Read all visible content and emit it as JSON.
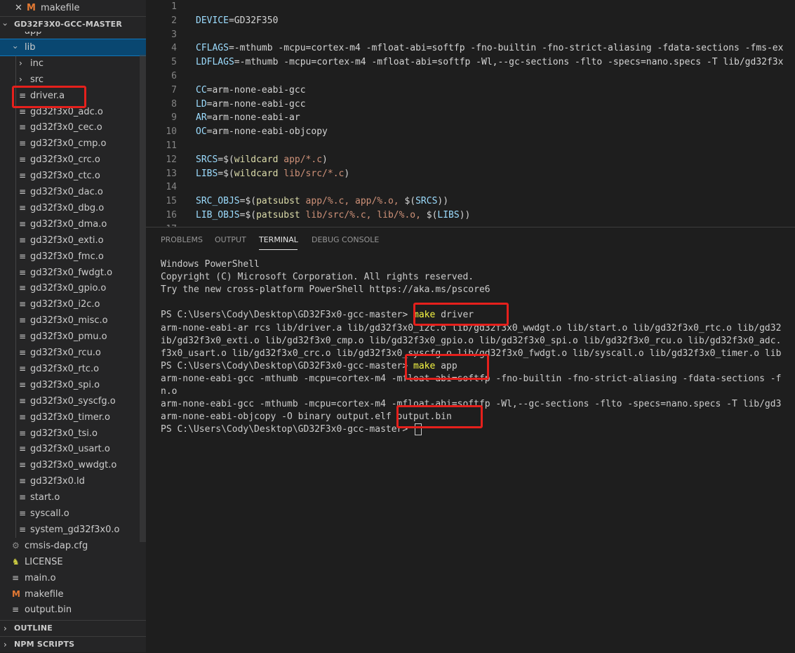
{
  "open_editor": {
    "close": "✕",
    "icon": "M",
    "name": "makefile"
  },
  "explorer": {
    "project_title": "GD32F3X0-GCC-MASTER",
    "partial_item": "app",
    "lib_folder": "lib",
    "subfolders": [
      "inc",
      "src"
    ],
    "lib_files": [
      "driver.a",
      "gd32f3x0_adc.o",
      "gd32f3x0_cec.o",
      "gd32f3x0_cmp.o",
      "gd32f3x0_crc.o",
      "gd32f3x0_ctc.o",
      "gd32f3x0_dac.o",
      "gd32f3x0_dbg.o",
      "gd32f3x0_dma.o",
      "gd32f3x0_exti.o",
      "gd32f3x0_fmc.o",
      "gd32f3x0_fwdgt.o",
      "gd32f3x0_gpio.o",
      "gd32f3x0_i2c.o",
      "gd32f3x0_misc.o",
      "gd32f3x0_pmu.o",
      "gd32f3x0_rcu.o",
      "gd32f3x0_rtc.o",
      "gd32f3x0_spi.o",
      "gd32f3x0_syscfg.o",
      "gd32f3x0_timer.o",
      "gd32f3x0_tsi.o",
      "gd32f3x0_usart.o",
      "gd32f3x0_wwdgt.o",
      "gd32f3x0.ld",
      "start.o",
      "syscall.o",
      "system_gd32f3x0.o"
    ],
    "root_files": [
      {
        "name": "cmsis-dap.cfg",
        "icon": "gear-icon",
        "glyph": "⚙",
        "color": "#8a8a8a"
      },
      {
        "name": "LICENSE",
        "icon": "license-icon",
        "glyph": "♞",
        "color": "#cbcb41"
      },
      {
        "name": "main.o",
        "icon": "lines-icon",
        "glyph": "≡",
        "color": "#cccccc"
      },
      {
        "name": "makefile",
        "icon": "makefile-icon",
        "glyph": "M",
        "color": "#e37933"
      },
      {
        "name": "output.bin",
        "icon": "lines-icon",
        "glyph": "≡",
        "color": "#cccccc"
      }
    ]
  },
  "outline": {
    "title": "OUTLINE"
  },
  "npm_scripts": {
    "title": "NPM SCRIPTS"
  },
  "editor": {
    "lines": [
      {
        "n": "1",
        "parts": []
      },
      {
        "n": "2",
        "parts": [
          {
            "t": "DEVICE",
            "c": "var"
          },
          {
            "t": "=",
            "c": "op"
          },
          {
            "t": "GD32F350",
            "c": "val"
          }
        ]
      },
      {
        "n": "3",
        "parts": []
      },
      {
        "n": "4",
        "parts": [
          {
            "t": "CFLAGS",
            "c": "var"
          },
          {
            "t": "=",
            "c": "op"
          },
          {
            "t": "-mthumb -mcpu=cortex-m4 -mfloat-abi=softfp -fno-builtin -fno-strict-aliasing -fdata-sections -fms-ex",
            "c": "val"
          }
        ]
      },
      {
        "n": "5",
        "parts": [
          {
            "t": "LDFLAGS",
            "c": "var"
          },
          {
            "t": "=",
            "c": "op"
          },
          {
            "t": "-mthumb -mcpu=cortex-m4 -mfloat-abi=softfp -Wl,--gc-sections -flto -specs=nano.specs -T lib/gd32f3x",
            "c": "val"
          }
        ]
      },
      {
        "n": "6",
        "parts": []
      },
      {
        "n": "7",
        "parts": [
          {
            "t": "CC",
            "c": "var"
          },
          {
            "t": "=",
            "c": "op"
          },
          {
            "t": "arm-none-eabi-gcc",
            "c": "val"
          }
        ]
      },
      {
        "n": "8",
        "parts": [
          {
            "t": "LD",
            "c": "var"
          },
          {
            "t": "=",
            "c": "op"
          },
          {
            "t": "arm-none-eabi-gcc",
            "c": "val"
          }
        ]
      },
      {
        "n": "9",
        "parts": [
          {
            "t": "AR",
            "c": "var"
          },
          {
            "t": "=",
            "c": "op"
          },
          {
            "t": "arm-none-eabi-ar",
            "c": "val"
          }
        ]
      },
      {
        "n": "10",
        "parts": [
          {
            "t": "OC",
            "c": "var"
          },
          {
            "t": "=",
            "c": "op"
          },
          {
            "t": "arm-none-eabi-objcopy",
            "c": "val"
          }
        ]
      },
      {
        "n": "11",
        "parts": []
      },
      {
        "n": "12",
        "parts": [
          {
            "t": "SRCS",
            "c": "var"
          },
          {
            "t": "=",
            "c": "op"
          },
          {
            "t": "$(",
            "c": "op"
          },
          {
            "t": "wildcard",
            "c": "fn"
          },
          {
            "t": " app/*.c",
            "c": "str"
          },
          {
            "t": ")",
            "c": "op"
          }
        ]
      },
      {
        "n": "13",
        "parts": [
          {
            "t": "LIBS",
            "c": "var"
          },
          {
            "t": "=",
            "c": "op"
          },
          {
            "t": "$(",
            "c": "op"
          },
          {
            "t": "wildcard",
            "c": "fn"
          },
          {
            "t": " lib/src/*.c",
            "c": "str"
          },
          {
            "t": ")",
            "c": "op"
          }
        ]
      },
      {
        "n": "14",
        "parts": []
      },
      {
        "n": "15",
        "parts": [
          {
            "t": "SRC_OBJS",
            "c": "var"
          },
          {
            "t": "=",
            "c": "op"
          },
          {
            "t": "$(",
            "c": "op"
          },
          {
            "t": "patsubst",
            "c": "fn"
          },
          {
            "t": " app/%.c, app/%.o, ",
            "c": "str"
          },
          {
            "t": "$(",
            "c": "op"
          },
          {
            "t": "SRCS",
            "c": "ref"
          },
          {
            "t": "))",
            "c": "op"
          }
        ]
      },
      {
        "n": "16",
        "parts": [
          {
            "t": "LIB_OBJS",
            "c": "var"
          },
          {
            "t": "=",
            "c": "op"
          },
          {
            "t": "$(",
            "c": "op"
          },
          {
            "t": "patsubst",
            "c": "fn"
          },
          {
            "t": " lib/src/%.c, lib/%.o, ",
            "c": "str"
          },
          {
            "t": "$(",
            "c": "op"
          },
          {
            "t": "LIBS",
            "c": "ref"
          },
          {
            "t": "))",
            "c": "op"
          }
        ]
      },
      {
        "n": "17",
        "parts": []
      }
    ]
  },
  "panel": {
    "tabs": [
      "PROBLEMS",
      "OUTPUT",
      "TERMINAL",
      "DEBUG CONSOLE"
    ],
    "active_tab": "TERMINAL",
    "terminal": [
      {
        "prompt": "",
        "text": "Windows PowerShell"
      },
      {
        "prompt": "",
        "text": "Copyright (C) Microsoft Corporation. All rights reserved."
      },
      {
        "prompt": "",
        "text": "Try the new cross-platform PowerShell https://aka.ms/pscore6"
      },
      {
        "prompt": "",
        "text": ""
      },
      {
        "prompt": "PS C:\\Users\\Cody\\Desktop\\GD32F3x0-gcc-master> ",
        "cmd": "make",
        "arg": " driver"
      },
      {
        "prompt": "",
        "text": "arm-none-eabi-ar rcs lib/driver.a lib/gd32f3x0_i2c.o lib/gd32f3x0_wwdgt.o lib/start.o lib/gd32f3x0_rtc.o lib/gd32"
      },
      {
        "prompt": "",
        "text": "ib/gd32f3x0_exti.o lib/gd32f3x0_cmp.o lib/gd32f3x0_gpio.o lib/gd32f3x0_spi.o lib/gd32f3x0_rcu.o lib/gd32f3x0_adc."
      },
      {
        "prompt": "",
        "text": "f3x0_usart.o lib/gd32f3x0_crc.o lib/gd32f3x0_syscfg.o lib/gd32f3x0_fwdgt.o lib/syscall.o lib/gd32f3x0_timer.o lib"
      },
      {
        "prompt": "PS C:\\Users\\Cody\\Desktop\\GD32F3x0-gcc-master> ",
        "cmd": "make",
        "arg": " app"
      },
      {
        "prompt": "",
        "text": "arm-none-eabi-gcc -mthumb -mcpu=cortex-m4 -mfloat-abi=softfp -fno-builtin -fno-strict-aliasing -fdata-sections -f"
      },
      {
        "prompt": "",
        "text": "n.o"
      },
      {
        "prompt": "",
        "text": "arm-none-eabi-gcc -mthumb -mcpu=cortex-m4 -mfloat-abi=softfp -Wl,--gc-sections -flto -specs=nano.specs -T lib/gd3"
      },
      {
        "prompt": "",
        "text": "arm-none-eabi-objcopy -O binary output.elf output.bin"
      },
      {
        "prompt": "PS C:\\Users\\Cody\\Desktop\\GD32F3x0-gcc-master> ",
        "cursor": true
      }
    ]
  }
}
